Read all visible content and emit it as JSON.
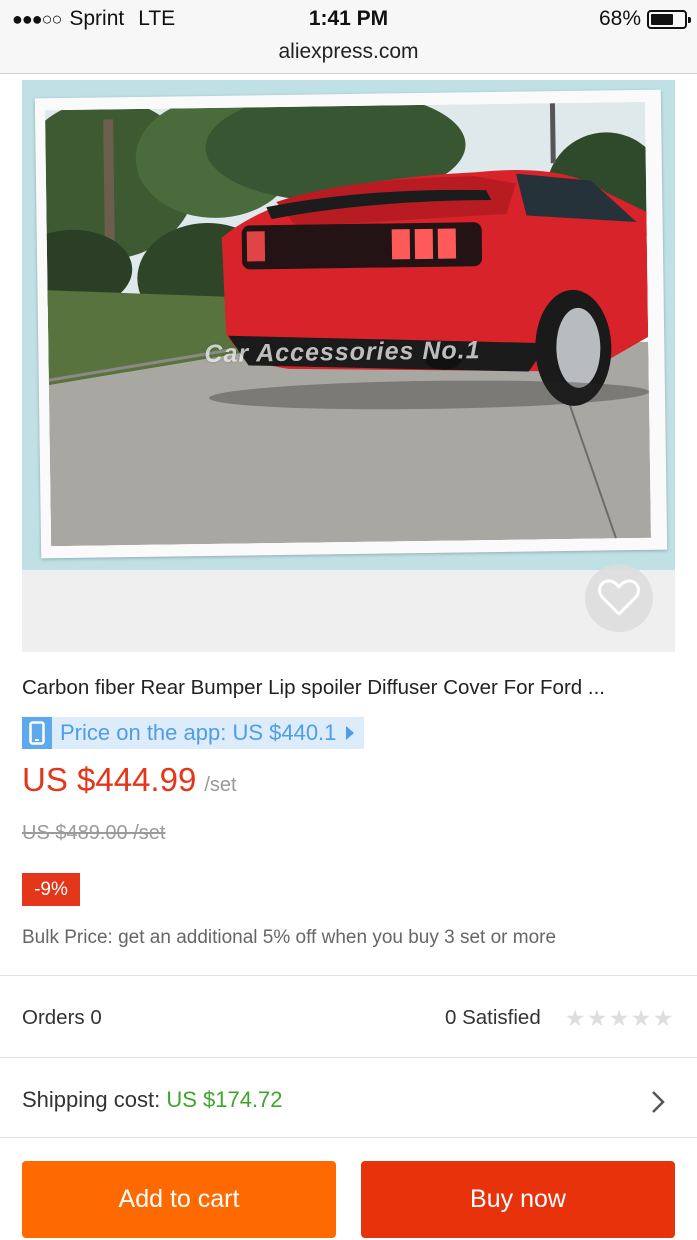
{
  "status_bar": {
    "signal_dots": "●●●○○",
    "carrier": "Sprint",
    "network": "LTE",
    "time": "1:41 PM",
    "battery_percent_text": "68%",
    "battery_level": 0.68
  },
  "browser": {
    "url": "aliexpress.com"
  },
  "product_image": {
    "watermark": "Car Accessories No.1",
    "favorite_icon": "heart-outline-icon"
  },
  "product": {
    "title": "Carbon fiber Rear Bumper Lip spoiler Diffuser Cover For Ford ...",
    "app_price_icon": "phone-icon",
    "app_price_text": "Price on the app: US $440.1",
    "price": "US $444.99",
    "price_unit": "/set",
    "original_price": "US $489.00 /set",
    "discount": "-9%",
    "bulk_price": "Bulk Price: get an additional 5% off when you buy 3 set or more"
  },
  "stats": {
    "orders": "Orders 0",
    "satisfied": "0 Satisfied",
    "rating_stars": 0,
    "max_stars": 5
  },
  "shipping": {
    "label": "Shipping cost:",
    "value": "US $174.72"
  },
  "actions": {
    "add_to_cart": "Add to cart",
    "buy_now": "Buy now"
  },
  "colors": {
    "price_red": "#e4361b",
    "add_to_cart": "#ff6a00",
    "buy_now": "#e8320c",
    "app_price_blue": "#4f9de6",
    "shipping_green": "#3ea62a"
  }
}
